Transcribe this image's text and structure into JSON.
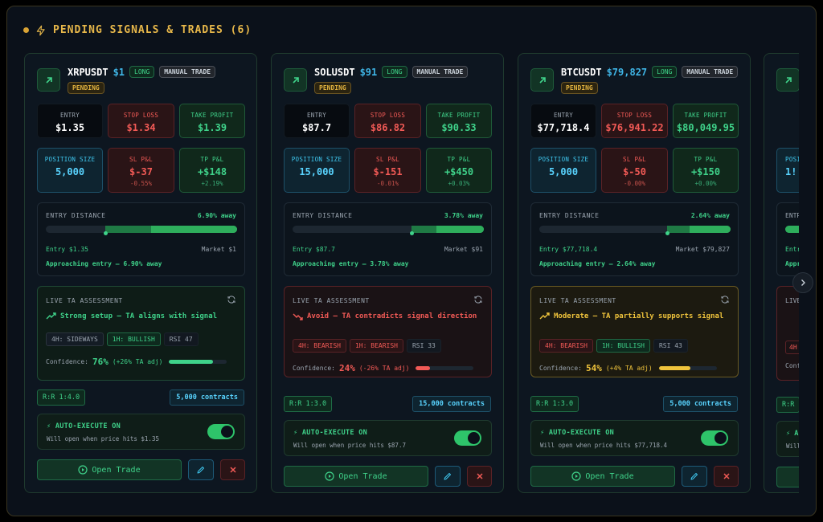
{
  "header": {
    "title": "PENDING SIGNALS & TRADES (6)"
  },
  "labels": {
    "entry": "ENTRY",
    "stop_loss": "STOP LOSS",
    "take_profit": "TAKE PROFIT",
    "position_size": "POSITION SIZE",
    "sl_pnl": "SL P&L",
    "tp_pnl": "TP P&L",
    "entry_distance": "ENTRY DISTANCE",
    "live_ta": "LIVE TA ASSESSMENT",
    "confidence": "Confidence:",
    "auto_execute": "⚡ AUTO-EXECUTE ON",
    "open_trade": "Open Trade",
    "long": "LONG",
    "manual": "MANUAL TRADE",
    "pending": "PENDING"
  },
  "colors": {
    "green": "#3fd28a",
    "red": "#f25a56",
    "yellow": "#f0c43c",
    "blue": "#59d4ff",
    "accent": "#e8b84a"
  },
  "cards": [
    {
      "symbol": "XRPUSDT",
      "price": "$1",
      "entry": "$1.35",
      "stop_loss": "$1.34",
      "take_profit": "$1.39",
      "position_size": "5,000",
      "sl_pnl": "$-37",
      "sl_pct": "-0.55%",
      "tp_pnl": "+$148",
      "tp_pct": "+2.19%",
      "distance_away": "6.90% away",
      "entry_text": "Entry $1.35",
      "market_text": "Market $1",
      "approaching": "Approaching entry — 6.90% away",
      "distance_fill": 0.69,
      "ta_verdict": "Strong setup — TA aligns with signal",
      "ta_tone": "good",
      "chips": [
        "4H: SIDEWAYS",
        "1H: BULLISH",
        "RSI 47"
      ],
      "confidence": "76%",
      "conf_adj": "(+26% TA adj)",
      "confidence_value": 0.76,
      "rr": "R:R 1:4.0",
      "contracts": "5,000 contracts",
      "auto_desc": "Will open when price hits $1.35"
    },
    {
      "symbol": "SOLUSDT",
      "price": "$91",
      "entry": "$87.7",
      "stop_loss": "$86.82",
      "take_profit": "$90.33",
      "position_size": "15,000",
      "sl_pnl": "$-151",
      "sl_pct": "-0.01%",
      "tp_pnl": "+$450",
      "tp_pct": "+0.03%",
      "distance_away": "3.78% away",
      "entry_text": "Entry $87.7",
      "market_text": "Market $91",
      "approaching": "Approaching entry — 3.78% away",
      "distance_fill": 0.38,
      "ta_verdict": "Avoid — TA contradicts signal direction",
      "ta_tone": "bad",
      "chips": [
        "4H: BEARISH",
        "1H: BEARISH",
        "RSI 33"
      ],
      "confidence": "24%",
      "conf_adj": "(-26% TA adj)",
      "confidence_value": 0.24,
      "rr": "R:R 1:3.0",
      "contracts": "15,000 contracts",
      "auto_desc": "Will open when price hits $87.7"
    },
    {
      "symbol": "BTCUSDT",
      "price": "$79,827",
      "entry": "$77,718.4",
      "stop_loss": "$76,941.22",
      "take_profit": "$80,049.95",
      "position_size": "5,000",
      "sl_pnl": "$-50",
      "sl_pct": "-0.00%",
      "tp_pnl": "+$150",
      "tp_pct": "+0.00%",
      "distance_away": "2.64% away",
      "entry_text": "Entry $77,718.4",
      "market_text": "Market $79,827",
      "approaching": "Approaching entry — 2.64% away",
      "distance_fill": 0.33,
      "ta_verdict": "Moderate — TA partially supports signal",
      "ta_tone": "mid",
      "chips": [
        "4H: BEARISH",
        "1H: BULLISH",
        "RSI 43"
      ],
      "confidence": "54%",
      "conf_adj": "(+4% TA adj)",
      "confidence_value": 0.54,
      "rr": "R:R 1:3.0",
      "contracts": "5,000 contracts",
      "auto_desc": "Will open when price hits $77,718.4"
    }
  ],
  "peek": {
    "pos": "POSI",
    "pos_val": "1!",
    "entr": "ENTR",
    "entr2": "Entr",
    "appr": "Appr",
    "live": "LIVE",
    "chip": "4H",
    "conf": "Conf",
    "rr": "R:R",
    "auto": "⚡ A",
    "will": "Will"
  }
}
